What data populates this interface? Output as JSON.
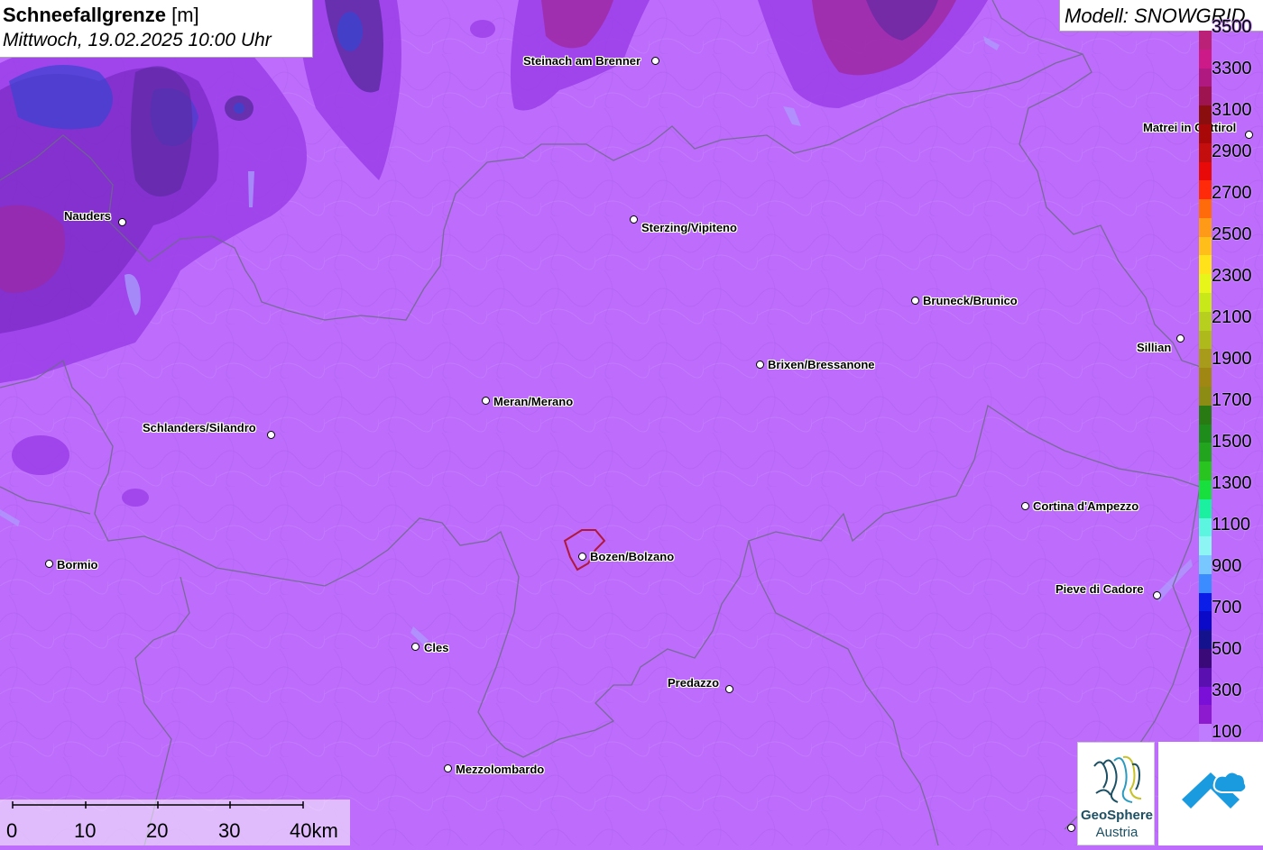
{
  "title": {
    "variable": "Schneefallgrenze",
    "unit": "[m]",
    "datetime": "Mittwoch, 19.02.2025 10:00 Uhr"
  },
  "model": {
    "label": "Modell: SNOWGRID"
  },
  "places": [
    {
      "name": "Steinach am Brenner"
    },
    {
      "name": "Nauders"
    },
    {
      "name": "Sterzing/Vipiteno"
    },
    {
      "name": "Matrei in Osttirol"
    },
    {
      "name": "Bruneck/Brunico"
    },
    {
      "name": "Sillian"
    },
    {
      "name": "Brixen/Bressanone"
    },
    {
      "name": "Meran/Merano"
    },
    {
      "name": "Schlanders/Silandro"
    },
    {
      "name": "Cortina d'Ampezzo"
    },
    {
      "name": "Bormio"
    },
    {
      "name": "Bozen/Bolzano"
    },
    {
      "name": "Pieve di Cadore"
    },
    {
      "name": "Cles"
    },
    {
      "name": "Predazzo"
    },
    {
      "name": "Mezzolombardo"
    }
  ],
  "legend": {
    "unit": "m",
    "labels": [
      "3500",
      "3300",
      "3100",
      "2900",
      "2700",
      "2500",
      "2300",
      "2100",
      "1900",
      "1700",
      "1500",
      "1300",
      "1100",
      "900",
      "700",
      "500",
      "300",
      "100"
    ],
    "colors": [
      "#bb2277",
      "#cc1a88",
      "#b01a80",
      "#9e1450",
      "#8a0e0e",
      "#a80808",
      "#c40d0d",
      "#e80909",
      "#ff2a0a",
      "#ff6a0a",
      "#ff9a18",
      "#ffbe1a",
      "#ffe21a",
      "#e8f51a",
      "#c8e81a",
      "#b7cf1e",
      "#aeb91c",
      "#a89a1a",
      "#a08714",
      "#8c8c14",
      "#2a7a14",
      "#1e8c1a",
      "#22a41e",
      "#29c420",
      "#18de3e",
      "#1bf0a0",
      "#5cf5e0",
      "#8ef5f5",
      "#78c8ff",
      "#3a8cff",
      "#0a1ee8",
      "#0a0ac8",
      "#14128c",
      "#3a0a78",
      "#5a10b0",
      "#7a10d8",
      "#8e1ad0",
      "#c07cff"
    ]
  },
  "scale_bar": {
    "labels": [
      "0",
      "10",
      "20",
      "30",
      "40km"
    ]
  },
  "logos": {
    "geosphere_line1": "GeoSphere",
    "geosphere_line2": "Austria"
  }
}
